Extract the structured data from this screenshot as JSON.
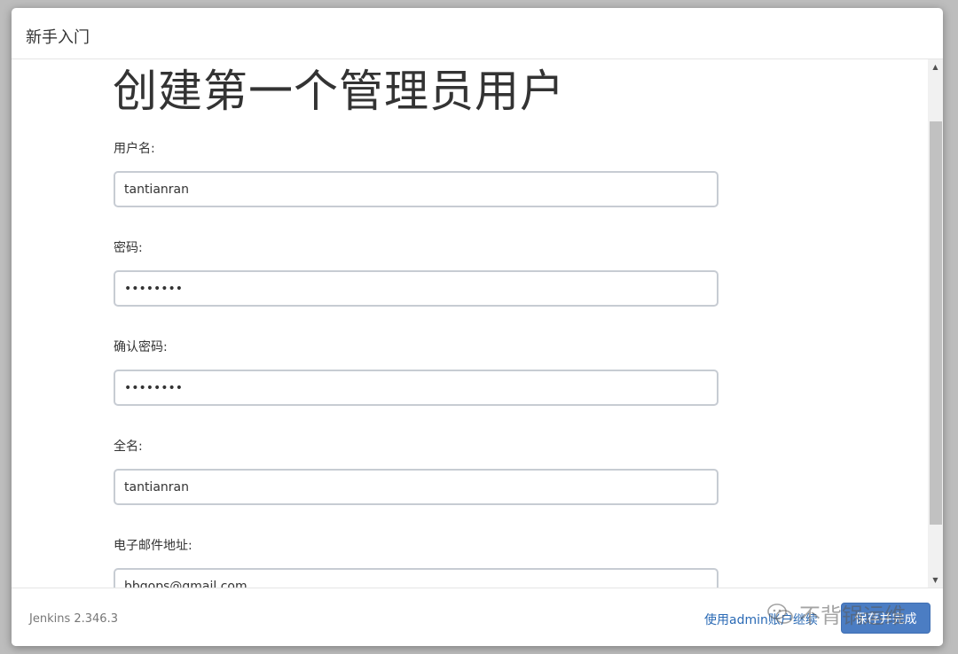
{
  "dialog": {
    "title": "新手入门"
  },
  "page": {
    "heading": "创建第一个管理员用户"
  },
  "form": {
    "username": {
      "label": "用户名:",
      "value": "tantianran"
    },
    "password": {
      "label": "密码:",
      "value": "••••••••"
    },
    "confirm_password": {
      "label": "确认密码:",
      "value": "••••••••"
    },
    "fullname": {
      "label": "全名:",
      "value": "tantianran"
    },
    "email": {
      "label": "电子邮件地址:",
      "value": "bbgops@gmail.com"
    }
  },
  "footer": {
    "version": "Jenkins 2.346.3",
    "skip_link": "使用admin账户继续",
    "save_button": "保存并完成"
  },
  "watermark": {
    "text": "不背锅运维",
    "icon": "wechat-icon"
  },
  "colors": {
    "primary_button": "#4b7dc3",
    "link": "#2a6ab5",
    "input_border": "#c7ccd3"
  }
}
